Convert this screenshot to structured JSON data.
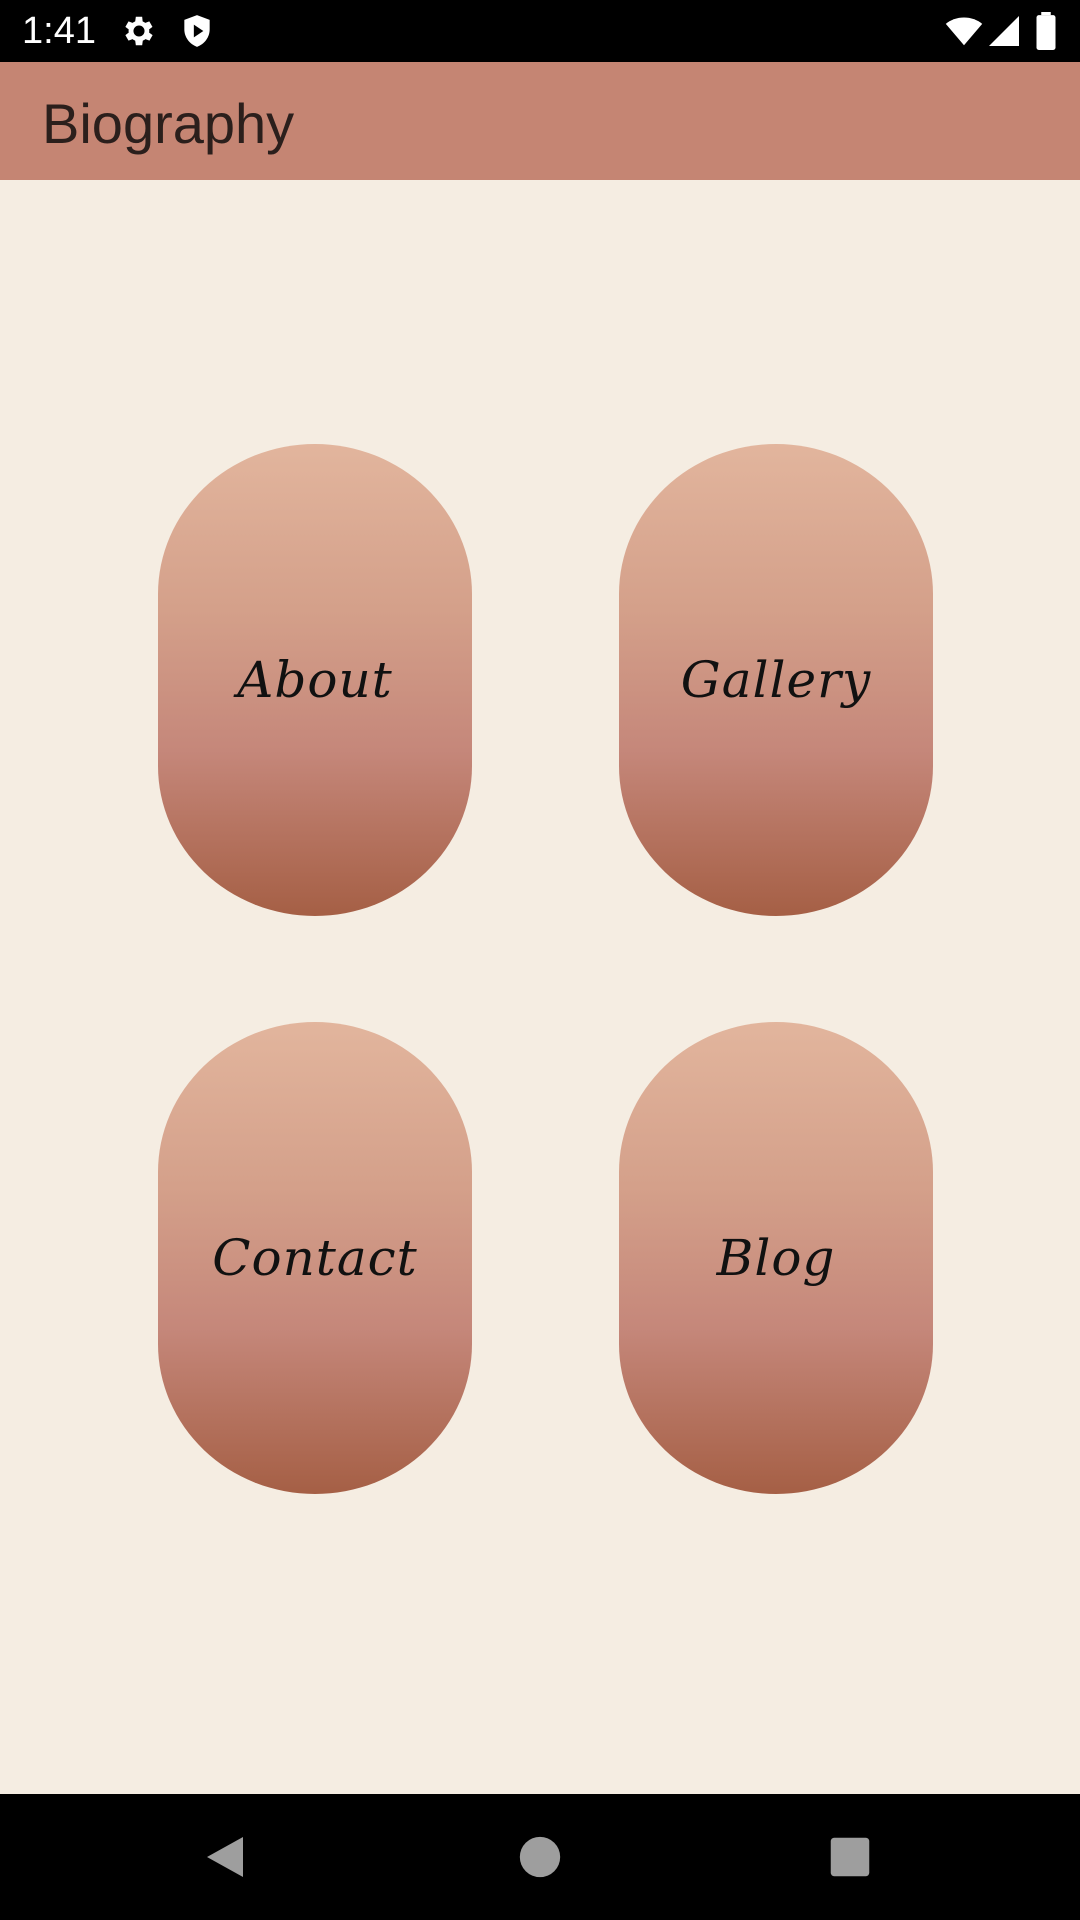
{
  "status_bar": {
    "time": "1:41",
    "left_icons": [
      "gear-icon",
      "shield-icon"
    ],
    "right_icons": [
      "wifi-icon",
      "signal-icon",
      "battery-icon"
    ]
  },
  "app_bar": {
    "title": "Biography"
  },
  "tiles": [
    {
      "label": "About"
    },
    {
      "label": "Gallery"
    },
    {
      "label": "Contact"
    },
    {
      "label": "Blog"
    }
  ],
  "colors": {
    "app_bar": "#c58573",
    "background": "#f5ede2",
    "tile_top": "#e2b59d",
    "tile_bottom": "#a55f45"
  },
  "nav_bar": {
    "buttons": [
      "back-icon",
      "home-icon",
      "recents-icon"
    ]
  }
}
